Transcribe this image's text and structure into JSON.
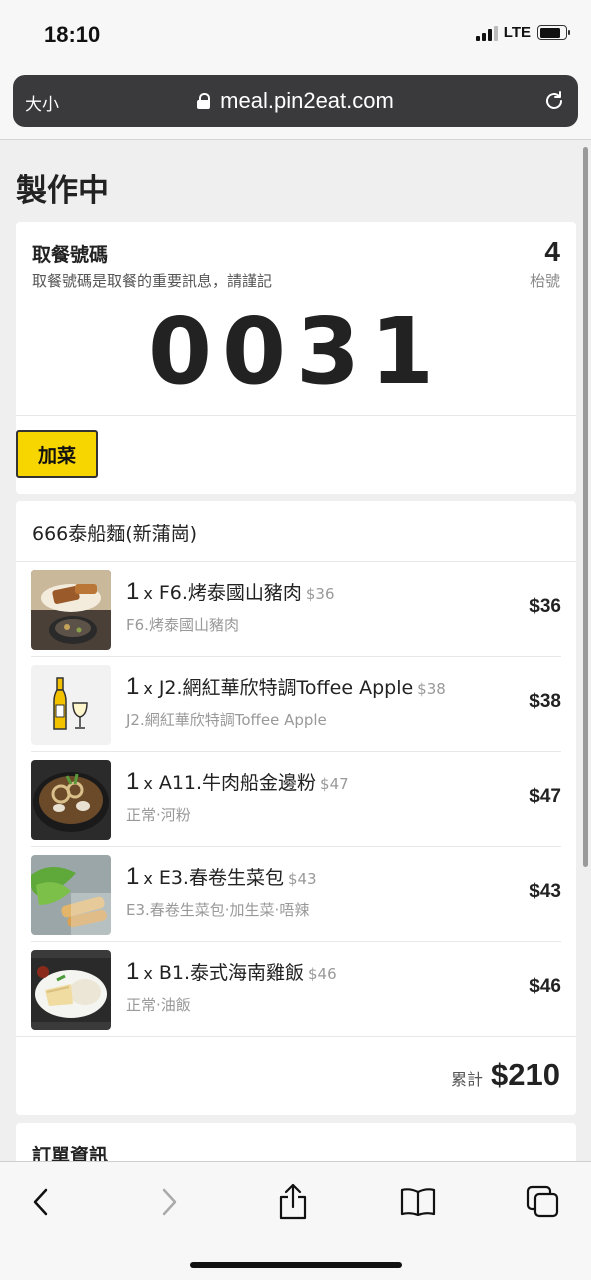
{
  "status": {
    "time": "18:10",
    "network": "LTE"
  },
  "browser": {
    "text_size": "大小",
    "url": "meal.pin2eat.com"
  },
  "page": {
    "title": "製作中",
    "pickup": {
      "label": "取餐號碼",
      "hint": "取餐號碼是取餐的重要訊息，請謹記",
      "number": "0031",
      "table_number": "4",
      "table_label": "枱號",
      "add_button": "加菜"
    },
    "order": {
      "store": "666泰船麵(新蒲崗)",
      "items": [
        {
          "qty": "1",
          "x": "x",
          "name": "F6.烤泰國山豬肉",
          "unit_price": "$36",
          "sub": "F6.烤泰國山豬肉",
          "price": "$36",
          "thumb": "grilled-pork"
        },
        {
          "qty": "1",
          "x": "x",
          "name": "J2.網紅華欣特調Toffee Apple",
          "unit_price": "$38",
          "sub": "J2.網紅華欣特調Toffee Apple",
          "price": "$38",
          "thumb": "wine-bottle"
        },
        {
          "qty": "1",
          "x": "x",
          "name": "A11.牛肉船金邊粉",
          "unit_price": "$47",
          "sub": "正常·河粉",
          "price": "$47",
          "thumb": "noodle-soup"
        },
        {
          "qty": "1",
          "x": "x",
          "name": "E3.春卷生菜包",
          "unit_price": "$43",
          "sub": "E3.春卷生菜包·加生菜·唔辣",
          "price": "$43",
          "thumb": "spring-rolls"
        },
        {
          "qty": "1",
          "x": "x",
          "name": "B1.泰式海南雞飯",
          "unit_price": "$46",
          "sub": "正常·油飯",
          "price": "$46",
          "thumb": "chicken-rice"
        }
      ],
      "total_label": "累計",
      "total": "$210"
    },
    "info_title": "訂單資訊"
  },
  "colors": {
    "accent": "#f7d600",
    "background": "#efefef",
    "url_bar": "#3a3a3c"
  }
}
